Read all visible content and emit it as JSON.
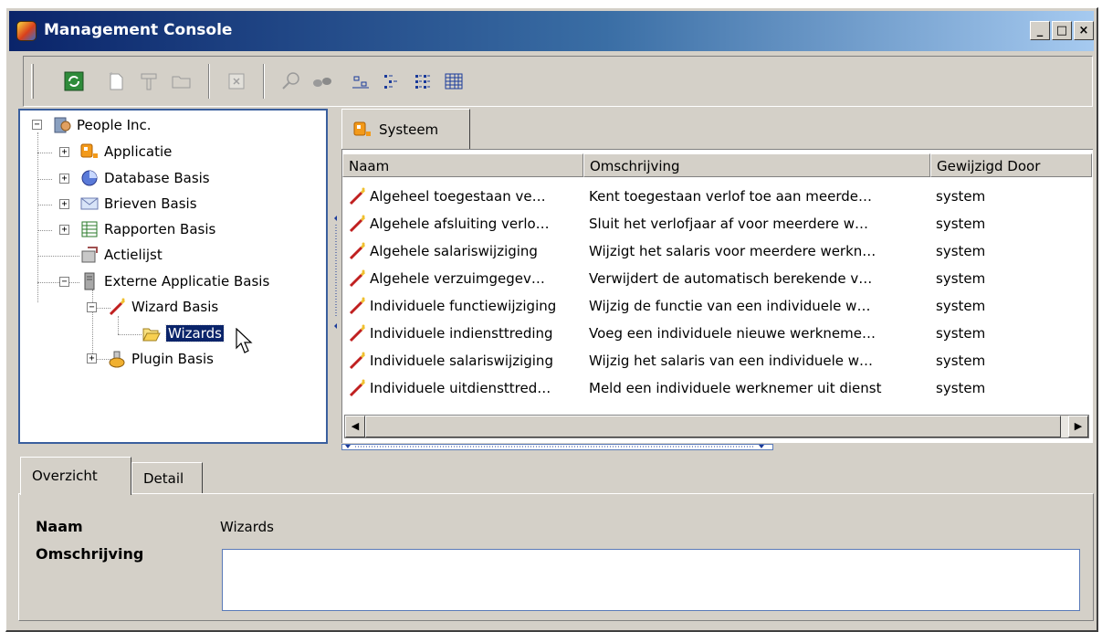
{
  "window": {
    "title": "Management Console",
    "buttons": {
      "minimize": "_",
      "maximize": "□",
      "close": "×"
    }
  },
  "toolbar": {
    "icons": [
      "refresh-icon",
      "new-icon",
      "properties-icon",
      "open-folder-icon",
      "delete-icon",
      "find-icon",
      "binoculars-icon",
      "large-icons-icon",
      "small-icons-icon",
      "list-view-icon",
      "details-view-icon"
    ]
  },
  "tree": {
    "root": "People Inc.",
    "items": [
      {
        "label": "Applicatie"
      },
      {
        "label": "Database Basis"
      },
      {
        "label": "Brieven Basis"
      },
      {
        "label": "Rapporten Basis"
      },
      {
        "label": "Actielijst"
      },
      {
        "label": "Externe Applicatie Basis"
      },
      {
        "label": "Wizard Basis"
      },
      {
        "label": "Wizards"
      },
      {
        "label": "Plugin Basis"
      }
    ]
  },
  "content": {
    "tab": "Systeem",
    "columns": [
      "Naam",
      "Omschrijving",
      "Gewijzigd Door"
    ],
    "rows": [
      {
        "naam": "Algeheel toegestaan ve…",
        "omschrijving": "Kent toegestaan verlof toe aan meerde…",
        "door": "system"
      },
      {
        "naam": "Algehele afsluiting verlo…",
        "omschrijving": "Sluit het verlofjaar af voor meerdere w…",
        "door": "system"
      },
      {
        "naam": "Algehele salariswijziging",
        "omschrijving": "Wijzigt het salaris voor meerdere werkn…",
        "door": "system"
      },
      {
        "naam": "Algehele verzuimgegev…",
        "omschrijving": "Verwijdert de automatisch berekende v…",
        "door": "system"
      },
      {
        "naam": "Individuele functiewijziging",
        "omschrijving": "Wijzig de functie van een individuele w…",
        "door": "system"
      },
      {
        "naam": "Individuele indiensttreding",
        "omschrijving": "Voeg een individuele nieuwe werkneme…",
        "door": "system"
      },
      {
        "naam": "Individuele salariswijziging",
        "omschrijving": "Wijzig het salaris van een individuele w…",
        "door": "system"
      },
      {
        "naam": "Individuele uitdiensttred…",
        "omschrijving": "Meld een individuele werknemer uit dienst",
        "door": "system"
      }
    ]
  },
  "bottom": {
    "tabs": [
      "Overzicht",
      "Detail"
    ],
    "naam_label": "Naam",
    "naam_value": "Wizards",
    "omschrijving_label": "Omschrijving",
    "omschrijving_value": ""
  }
}
